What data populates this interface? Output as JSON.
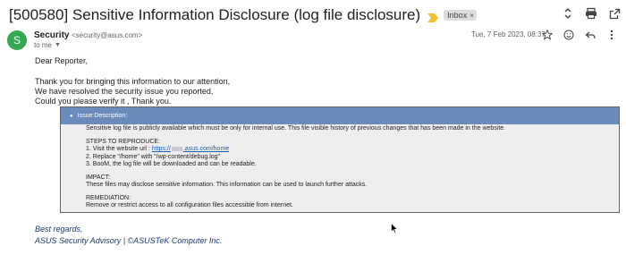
{
  "email": {
    "subject": "[500580] Sensitive Information Disclosure (log file disclosure)",
    "label": "Inbox",
    "label_close": "×",
    "sender": {
      "avatar_initial": "S",
      "name": "Security",
      "email": "<security@asus.com>",
      "to": "to me",
      "date": "Tue, 7 Feb 2023, 08:37"
    },
    "body": {
      "greeting": "Dear Reporter,",
      "lines": [
        "Thank you for bringing this information to our attention,",
        "We have resolved the security issue you reported,",
        "Could you please verify it , Thank you."
      ]
    },
    "issue": {
      "header": "Issue Description:",
      "summary": "Sensitive log file is publicly available which must be only for internal use. This file visible history of previous changes that has been made in the website.",
      "steps_title": "STEPS TO REPRODUCE:",
      "step1_prefix": "1. Visit the website url : ",
      "step1_link_a": "https://",
      "step1_link_b": ".asus.com/home",
      "step2": "2. Replace \"/home\" with \"/wp-content/debug.log\"",
      "step3": "3. BooM, the log file will be downloaded and can be readable.",
      "impact_title": "IMPACT:",
      "impact": "These files may disclose sensitive information. This information can be used to launch further attacks.",
      "remediation_title": "REMEDIATION:",
      "remediation": "Remove or restrict access to all configuration files accessible from internet."
    },
    "signature": {
      "line1": "Best regards,",
      "line2": "ASUS Security Advisory | ©ASUSTeK Computer Inc."
    }
  },
  "icons": {
    "importance": "importance-marker-icon",
    "expand": "expand-collapse-icon",
    "print": "print-icon",
    "open_new_window": "open-in-new-window-icon",
    "star": "star-icon",
    "emoji": "emoji-icon",
    "reply": "reply-icon",
    "more": "more-vertical-icon"
  },
  "colors": {
    "avatar": "#34a853",
    "importance": "#f2c12e",
    "issue_header": "#6b8cba",
    "issue_body": "#eeeeee",
    "link": "#1a5fb4",
    "signature": "#1f3a6b"
  }
}
